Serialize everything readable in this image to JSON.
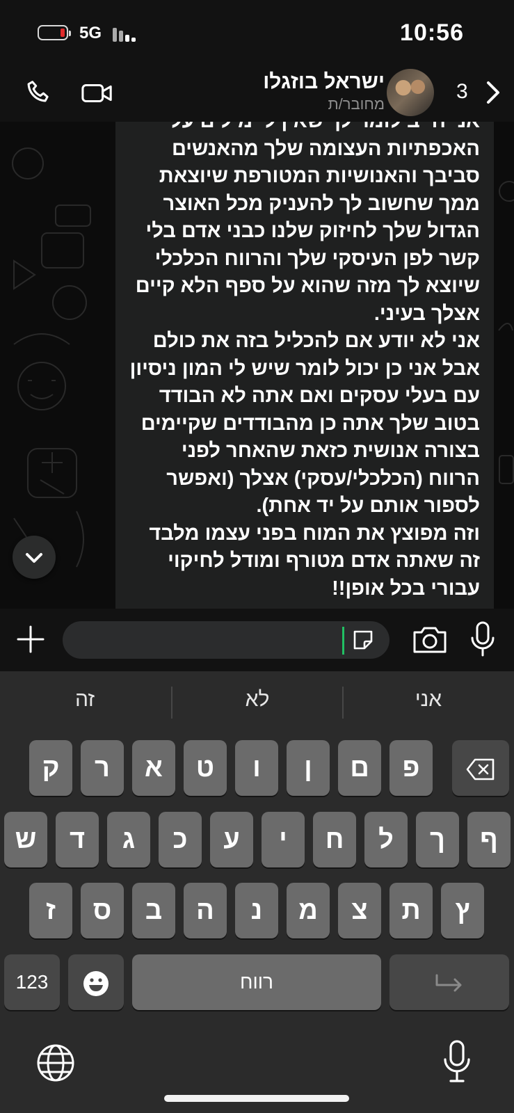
{
  "status_bar": {
    "network": "5G",
    "time": "10:56"
  },
  "header": {
    "contact_name": "ישראל בוזגלו",
    "contact_status": "מחובר/ת",
    "back_count": "3"
  },
  "message": {
    "lines": [
      "אני חייב לומר לך שאין לי מילים על",
      "האכפתיות העצומה שלך מהאנשים",
      "סביבך והאנושיות המטורפת שיוצאת",
      "ממך שחשוב לך להעניק מכל האוצר",
      "הגדול שלך לחיזוק שלנו כבני אדם בלי",
      "קשר לפן העיסקי שלך והרווח הכלכלי",
      "שיוצא לך מזה שהוא על ספף הלא קיים",
      "אצלך בעיני.",
      "אני לא יודע אם להכליל בזה את כולם",
      "אבל אני כן יכול לומר שיש לי המון ניסיון",
      "עם בעלי עסקים ואם אתה לא ",
      "בטוב שלך אתה כן מהבודדים שקיימים",
      "בצורה אנושית כזאת שהאחר לפני",
      "הרווח (הכלכלי/עסקי) אצלך (ואפשר",
      "לספור אותם על יד אחת).",
      "וזה מפוצץ את המוח בפני עצמו מלבד",
      "זה שאתה אדם מטורף ומודל לחיקוי",
      " בכל אופן!!"
    ],
    "bold_word_1": "הבודד",
    "bold_word_2": "עבורי"
  },
  "input": {
    "placeholder": ""
  },
  "keyboard": {
    "suggestions": [
      "זה",
      "לא",
      "אני"
    ],
    "row1": [
      "ק",
      "ר",
      "א",
      "ט",
      "ו",
      "ן",
      "ם",
      "פ"
    ],
    "row2": [
      "ש",
      "ד",
      "ג",
      "כ",
      "ע",
      "י",
      "ח",
      "ל",
      "ך",
      "ף"
    ],
    "row3": [
      "ז",
      "ס",
      "ב",
      "ה",
      "נ",
      "מ",
      "צ",
      "ת",
      "ץ"
    ],
    "numbers_label": "123",
    "space_label": "רווח"
  },
  "colors": {
    "accent": "#21c063",
    "battery_low": "#e02b2b"
  }
}
